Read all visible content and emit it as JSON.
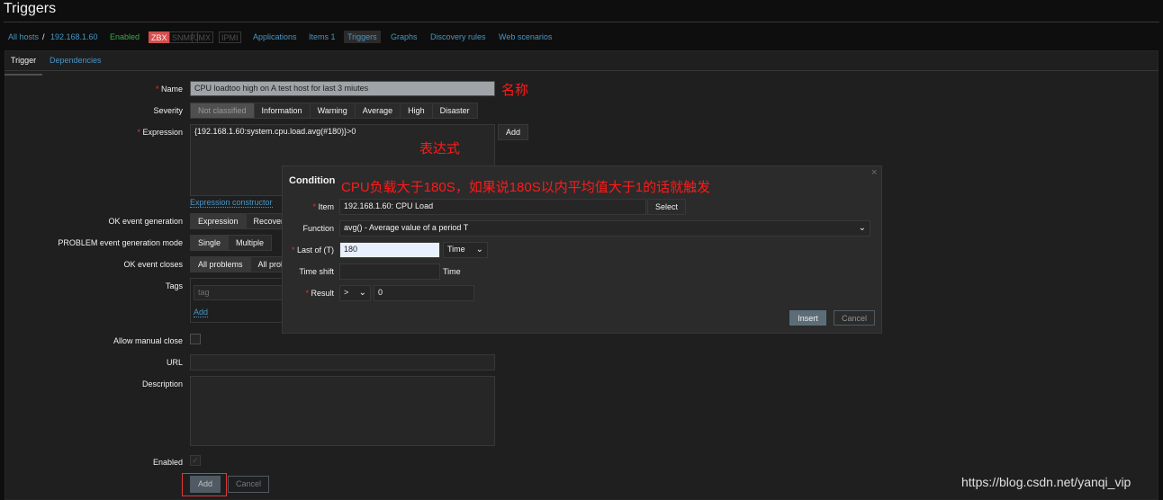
{
  "page_title": "Triggers",
  "nav": {
    "all_hosts": "All hosts",
    "sep": "/",
    "host": "192.168.1.60",
    "status": "Enabled",
    "zbx": "ZBX",
    "snmp": "SNMP",
    "jmx": "JMX",
    "ipmi": "IPMI",
    "applications": "Applications",
    "items": "Items 1",
    "triggers": "Triggers",
    "graphs": "Graphs",
    "discovery": "Discovery rules",
    "web": "Web scenarios"
  },
  "tabs": [
    "Trigger",
    "Dependencies"
  ],
  "form": {
    "name_label": "Name",
    "name_value": "CPU loadtoo high on A test host for last 3 miutes",
    "severity_label": "Severity",
    "severities": [
      "Not classified",
      "Information",
      "Warning",
      "Average",
      "High",
      "Disaster"
    ],
    "expression_label": "Expression",
    "expression_value": "{192.168.1.60:system.cpu.load.avg(#180)}>0",
    "add_label": "Add",
    "expression_constructor": "Expression constructor",
    "ok_gen_label": "OK event generation",
    "ok_gen_options": [
      "Expression",
      "Recovery expression"
    ],
    "problem_mode_label": "PROBLEM event generation mode",
    "problem_mode_options": [
      "Single",
      "Multiple"
    ],
    "ok_closes_label": "OK event closes",
    "ok_closes_options": [
      "All problems",
      "All problems if tag values match"
    ],
    "tags_label": "Tags",
    "tag_placeholder": "tag",
    "tags_add": "Add",
    "manual_close_label": "Allow manual close",
    "url_label": "URL",
    "description_label": "Description",
    "enabled_label": "Enabled",
    "submit": "Add",
    "cancel": "Cancel"
  },
  "annotations": {
    "name": "名称",
    "expression": "表达式",
    "condition": "CPU负载大于180S，如果说180S以内平均值大于1的话就触发"
  },
  "dialog": {
    "title": "Condition",
    "close": "×",
    "item_label": "Item",
    "item_value": "192.168.1.60: CPU Load",
    "select": "Select",
    "function_label": "Function",
    "function_value": "avg() - Average value of a period T",
    "last_label": "Last of (T)",
    "last_value": "180",
    "last_unit": "Time",
    "shift_label": "Time shift",
    "shift_unit": "Time",
    "result_label": "Result",
    "result_op": ">",
    "result_value": "0",
    "insert": "Insert",
    "cancel": "Cancel"
  },
  "watermark": "https://blog.csdn.net/yanqi_vip",
  "colors": {
    "accent": "#4796c4",
    "enabled": "#3aaa48",
    "zbx": "#d64e4e",
    "annotation": "#ff1a1a"
  }
}
